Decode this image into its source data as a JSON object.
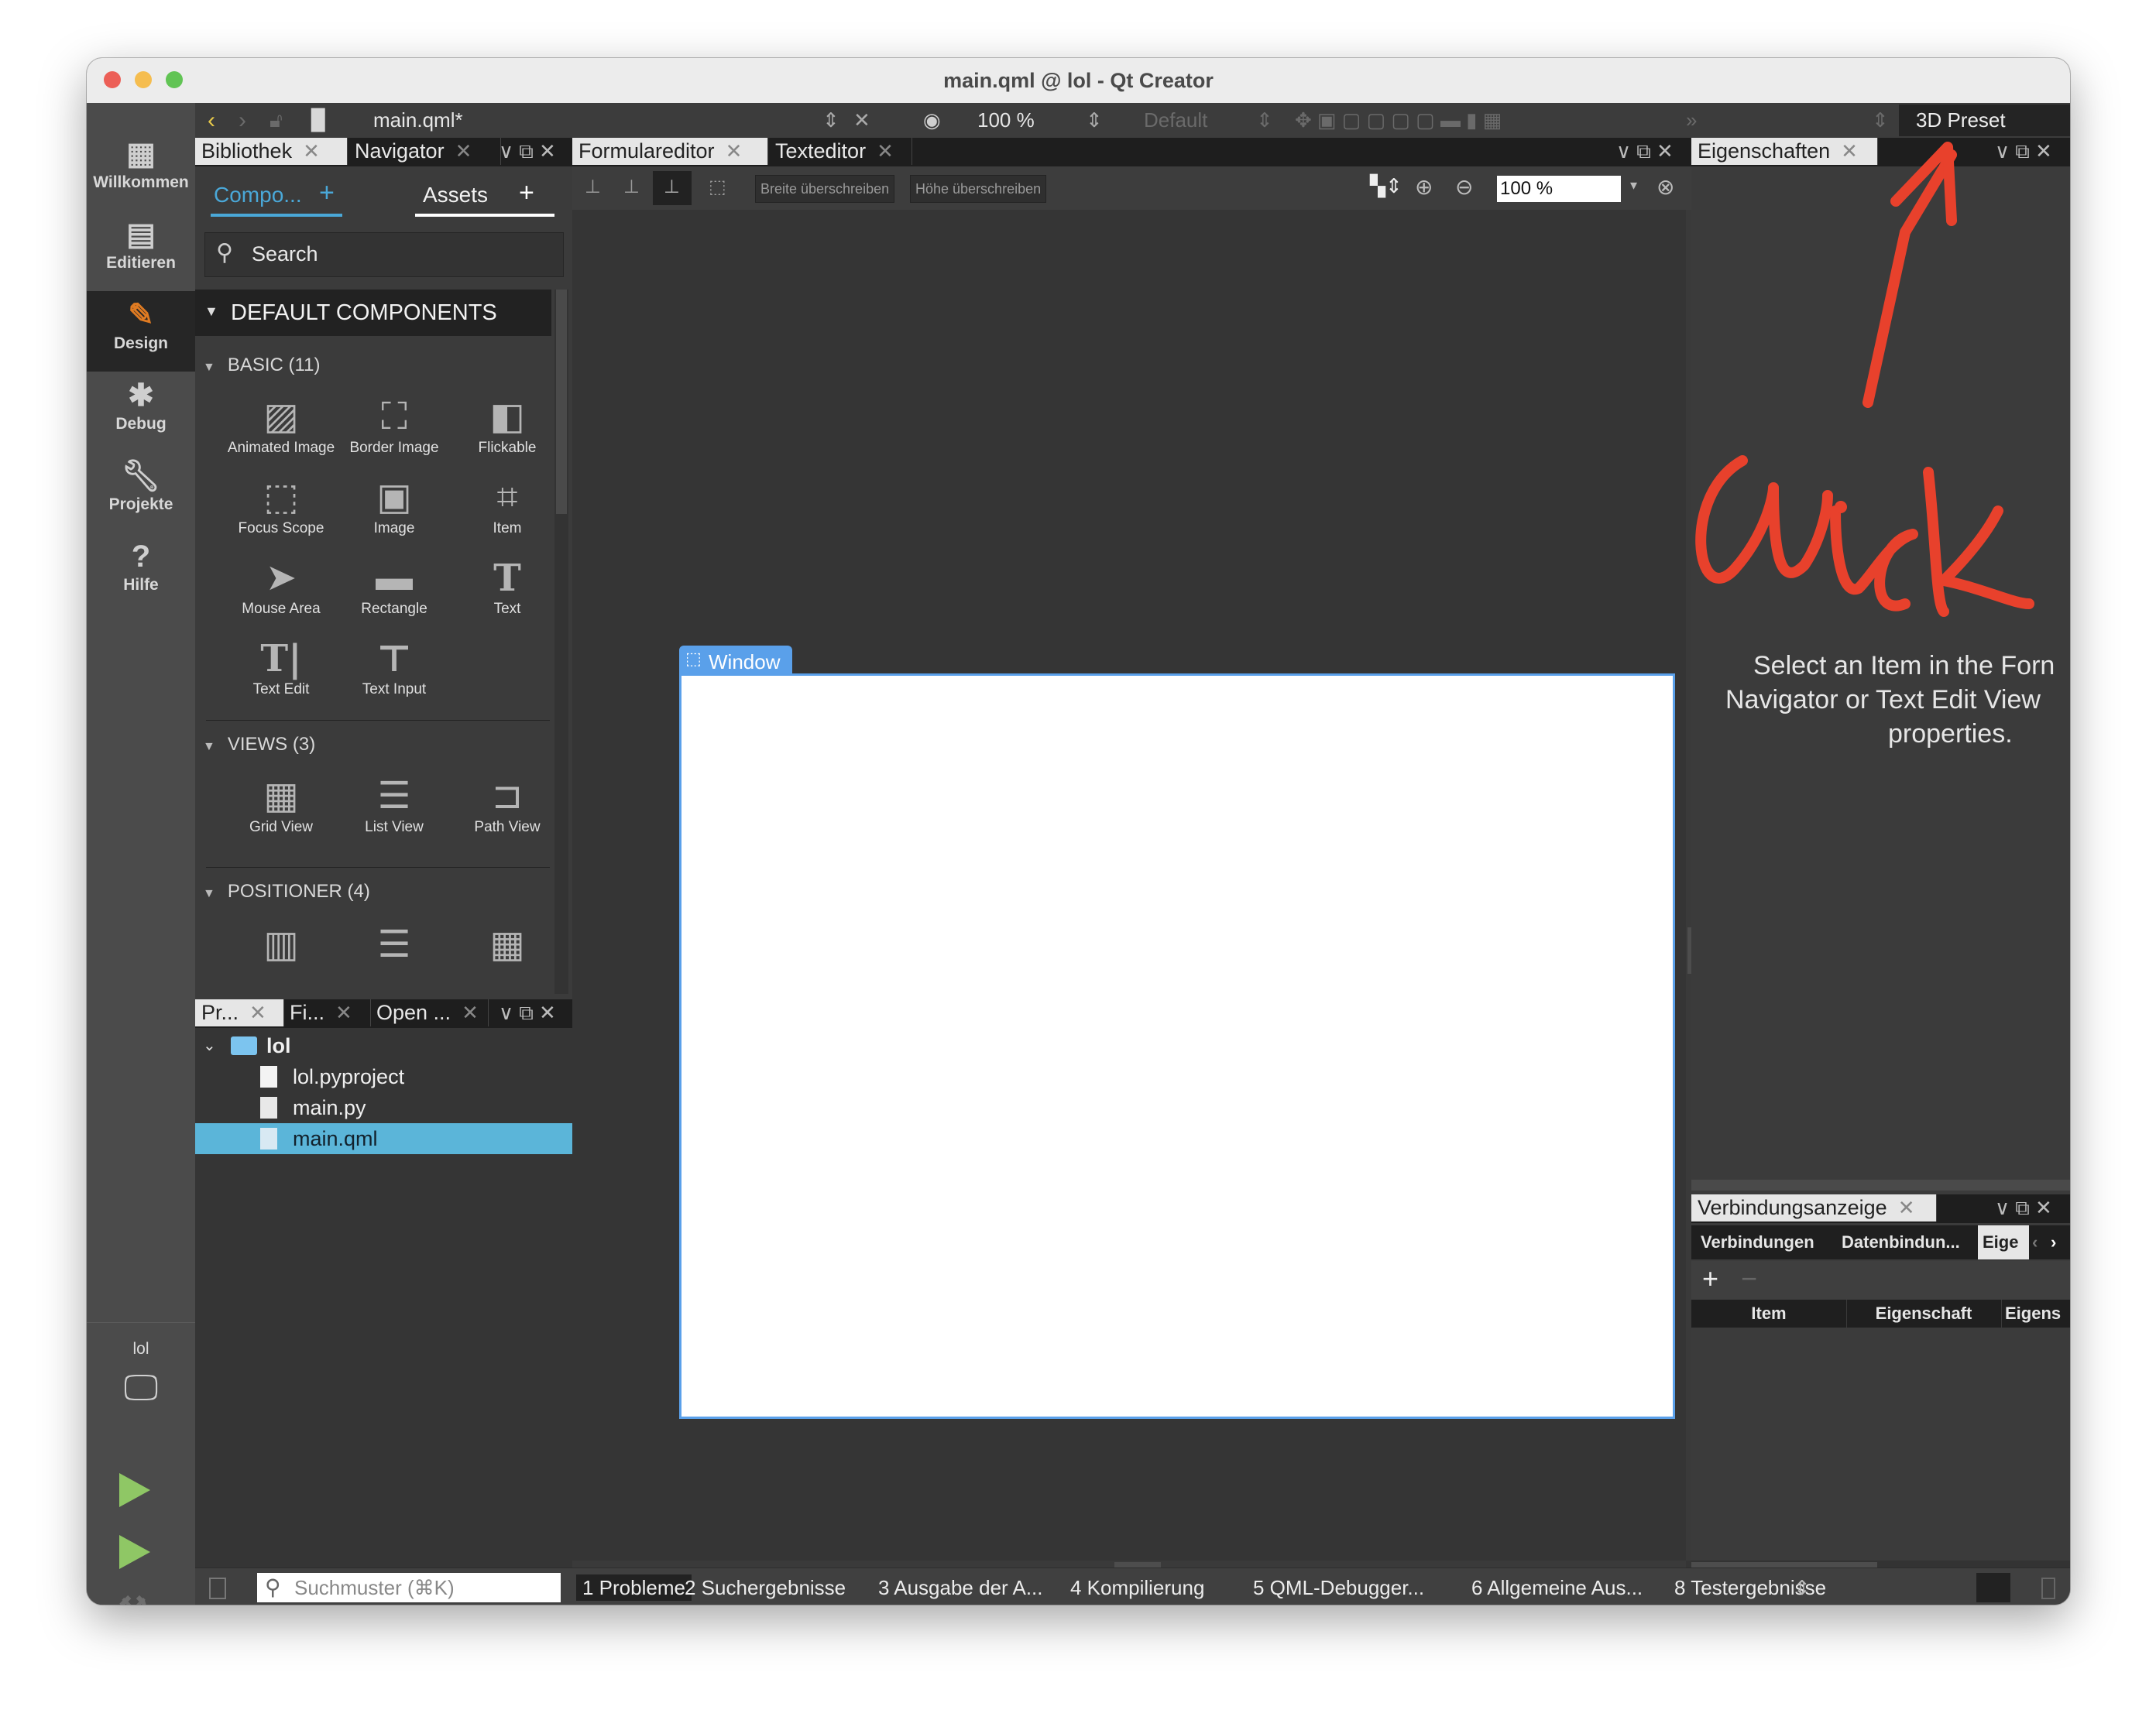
{
  "window": {
    "title": "main.qml @ lol - Qt Creator",
    "traffic_lights": {
      "close": "#ec5f57",
      "minimize": "#f5bd4f",
      "maximize": "#61c454"
    }
  },
  "toolbar": {
    "back_icon": "chevron-left-icon",
    "forward_icon": "chevron-right-icon",
    "file_name": "main.qml*",
    "zoom_value": "100 %",
    "state_value": "Default",
    "overflow": "»",
    "preset_value": "3D Preset"
  },
  "mode_bar": {
    "items": [
      {
        "label": "Willkommen",
        "icon": "grid-icon"
      },
      {
        "label": "Editieren",
        "icon": "document-icon"
      },
      {
        "label": "Design",
        "icon": "pencil-icon"
      },
      {
        "label": "Debug",
        "icon": "bug-icon"
      },
      {
        "label": "Projekte",
        "icon": "wrench-icon"
      },
      {
        "label": "Hilfe",
        "icon": "help-icon"
      }
    ],
    "active": "Design",
    "kit_label": "lol"
  },
  "library": {
    "tabs": [
      "Bibliothek",
      "Navigator"
    ],
    "subtabs": {
      "components": "Compo...",
      "assets": "Assets",
      "add": "+"
    },
    "search_placeholder": "Search",
    "header": "DEFAULT COMPONENTS",
    "sections": [
      {
        "title": "BASIC (11)",
        "items": [
          "Animated Image",
          "Border Image",
          "Flickable",
          "Focus Scope",
          "Image",
          "Item",
          "Mouse Area",
          "Rectangle",
          "Text",
          "Text Edit",
          "Text Input"
        ]
      },
      {
        "title": "VIEWS (3)",
        "items": [
          "Grid View",
          "List View",
          "Path View"
        ]
      },
      {
        "title": "POSITIONER (4)",
        "items": [
          "Column",
          "Row",
          "Grid"
        ]
      }
    ]
  },
  "project_panel": {
    "tabs": [
      "Pr...",
      "Fi...",
      "Open ..."
    ],
    "tree": [
      {
        "name": "lol",
        "type": "folder"
      },
      {
        "name": "lol.pyproject",
        "type": "file"
      },
      {
        "name": "main.py",
        "type": "py"
      },
      {
        "name": "main.qml",
        "type": "qml",
        "selected": true
      }
    ]
  },
  "editor": {
    "tabs": [
      "Formulareditor",
      "Texteditor"
    ],
    "override_width": "Breite überschreiben",
    "override_height": "Höhe überschreiben",
    "zoom_value": "100 %",
    "canvas_item_label": "Window"
  },
  "properties": {
    "tab": "Eigenschaften",
    "message": "Select an Item in the Form Editor, Navigator or Text Edit View to see its properties.",
    "message_lines": [
      "Select an Item in the Forn",
      "Navigator or Text Edit View",
      "properties."
    ]
  },
  "connections": {
    "tab": "Verbindungsanzeige",
    "subtabs": [
      "Verbindungen",
      "Datenbindun...",
      "Eige"
    ],
    "columns": [
      "Item",
      "Eigenschaft",
      "Eigens"
    ]
  },
  "status_bar": {
    "search_placeholder": "Suchmuster (⌘K)",
    "panes": [
      "1  Probleme",
      "2  Suchergebnisse",
      "3  Ausgabe der A...",
      "4  Kompilierung",
      "5  QML-Debugger...",
      "6  Allgemeine Aus...",
      "8  Testergebnisse"
    ]
  },
  "annotation": {
    "text": "Click",
    "color": "#e8412c"
  }
}
